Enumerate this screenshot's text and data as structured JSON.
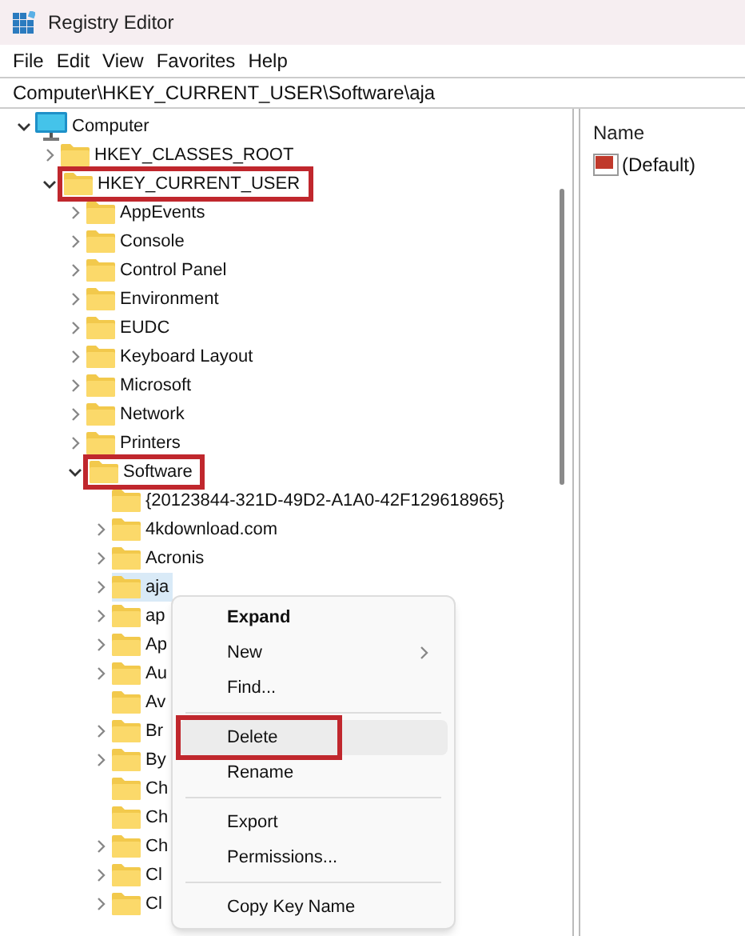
{
  "window": {
    "title": "Registry Editor"
  },
  "menu_bar": [
    "File",
    "Edit",
    "View",
    "Favorites",
    "Help"
  ],
  "address": "Computer\\HKEY_CURRENT_USER\\Software\\aja",
  "tree": [
    {
      "label": "Computer",
      "kind": "computer",
      "expanded": true,
      "selected": false,
      "highlighted": false,
      "children": [
        {
          "label": "HKEY_CLASSES_ROOT",
          "kind": "folder",
          "expanded": false,
          "selected": false,
          "highlighted": false
        },
        {
          "label": "HKEY_CURRENT_USER",
          "kind": "folder",
          "expanded": true,
          "selected": false,
          "highlighted": true,
          "children": [
            {
              "label": "AppEvents",
              "kind": "folder",
              "expanded": false,
              "selected": false,
              "highlighted": false
            },
            {
              "label": "Console",
              "kind": "folder",
              "expanded": false,
              "selected": false,
              "highlighted": false
            },
            {
              "label": "Control Panel",
              "kind": "folder",
              "expanded": false,
              "selected": false,
              "highlighted": false
            },
            {
              "label": "Environment",
              "kind": "folder",
              "expanded": false,
              "selected": false,
              "highlighted": false
            },
            {
              "label": "EUDC",
              "kind": "folder",
              "expanded": false,
              "selected": false,
              "highlighted": false
            },
            {
              "label": "Keyboard Layout",
              "kind": "folder",
              "expanded": false,
              "selected": false,
              "highlighted": false
            },
            {
              "label": "Microsoft",
              "kind": "folder",
              "expanded": false,
              "selected": false,
              "highlighted": false
            },
            {
              "label": "Network",
              "kind": "folder",
              "expanded": false,
              "selected": false,
              "highlighted": false
            },
            {
              "label": "Printers",
              "kind": "folder",
              "expanded": false,
              "selected": false,
              "highlighted": false
            },
            {
              "label": "Software",
              "kind": "folder",
              "expanded": true,
              "selected": false,
              "highlighted": true,
              "children": [
                {
                  "label": "{20123844-321D-49D2-A1A0-42F129618965}",
                  "kind": "leaf",
                  "expanded": false,
                  "selected": false,
                  "highlighted": false
                },
                {
                  "label": "4kdownload.com",
                  "kind": "folder",
                  "expanded": false,
                  "selected": false,
                  "highlighted": false
                },
                {
                  "label": "Acronis",
                  "kind": "folder",
                  "expanded": false,
                  "selected": false,
                  "highlighted": false
                },
                {
                  "label": "aja",
                  "kind": "folder",
                  "expanded": false,
                  "selected": true,
                  "highlighted": false
                },
                {
                  "label": "ap",
                  "kind": "folder",
                  "expanded": false,
                  "selected": false,
                  "highlighted": false
                },
                {
                  "label": "Ap",
                  "kind": "folder",
                  "expanded": false,
                  "selected": false,
                  "highlighted": false
                },
                {
                  "label": "Au",
                  "kind": "folder",
                  "expanded": false,
                  "selected": false,
                  "highlighted": false
                },
                {
                  "label": "Av",
                  "kind": "leaf",
                  "expanded": false,
                  "selected": false,
                  "highlighted": false
                },
                {
                  "label": "Br",
                  "kind": "folder",
                  "expanded": false,
                  "selected": false,
                  "highlighted": false
                },
                {
                  "label": "By",
                  "kind": "folder",
                  "expanded": false,
                  "selected": false,
                  "highlighted": false
                },
                {
                  "label": "Ch",
                  "kind": "leaf",
                  "expanded": false,
                  "selected": false,
                  "highlighted": false
                },
                {
                  "label": "Ch",
                  "kind": "leaf",
                  "expanded": false,
                  "selected": false,
                  "highlighted": false
                },
                {
                  "label": "Ch",
                  "kind": "folder",
                  "expanded": false,
                  "selected": false,
                  "highlighted": false
                },
                {
                  "label": "Cl",
                  "kind": "folder",
                  "expanded": false,
                  "selected": false,
                  "highlighted": false
                },
                {
                  "label": "Cl",
                  "kind": "folder",
                  "expanded": false,
                  "selected": false,
                  "highlighted": false
                }
              ]
            }
          ]
        }
      ]
    }
  ],
  "values_pane": {
    "column": "Name",
    "rows": [
      {
        "name": "(Default)"
      }
    ]
  },
  "context_menu": [
    {
      "label": "Expand",
      "kind": "item",
      "bold": true,
      "submenu": false,
      "hovered": false,
      "highlighted": false
    },
    {
      "label": "New",
      "kind": "item",
      "bold": false,
      "submenu": true,
      "hovered": false,
      "highlighted": false
    },
    {
      "label": "Find...",
      "kind": "item",
      "bold": false,
      "submenu": false,
      "hovered": false,
      "highlighted": false
    },
    {
      "kind": "separator"
    },
    {
      "label": "Delete",
      "kind": "item",
      "bold": false,
      "submenu": false,
      "hovered": true,
      "highlighted": true
    },
    {
      "label": "Rename",
      "kind": "item",
      "bold": false,
      "submenu": false,
      "hovered": false,
      "highlighted": false
    },
    {
      "kind": "separator"
    },
    {
      "label": "Export",
      "kind": "item",
      "bold": false,
      "submenu": false,
      "hovered": false,
      "highlighted": false
    },
    {
      "label": "Permissions...",
      "kind": "item",
      "bold": false,
      "submenu": false,
      "hovered": false,
      "highlighted": false
    },
    {
      "kind": "separator"
    },
    {
      "label": "Copy Key Name",
      "kind": "item",
      "bold": false,
      "submenu": false,
      "hovered": false,
      "highlighted": false
    }
  ]
}
